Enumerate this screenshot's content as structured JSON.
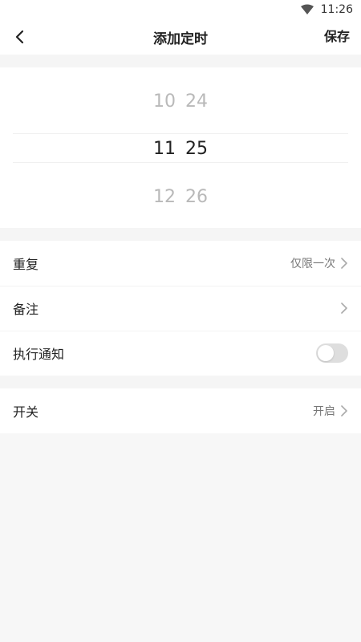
{
  "status_bar": {
    "time": "11:26",
    "wifi_icon": "wifi-icon"
  },
  "header": {
    "title": "添加定时",
    "save_label": "保存",
    "back_icon": "chevron-left-icon"
  },
  "time_picker": {
    "rows": [
      {
        "hour": "10",
        "minute": "24"
      },
      {
        "hour": "11",
        "minute": "25"
      },
      {
        "hour": "12",
        "minute": "26"
      }
    ],
    "selected_index": 1
  },
  "settings": {
    "repeat": {
      "label": "重复",
      "value": "仅限一次"
    },
    "note": {
      "label": "备注",
      "value": ""
    },
    "notify": {
      "label": "执行通知",
      "enabled": false
    }
  },
  "switch_section": {
    "label": "开关",
    "value": "开启"
  },
  "colors": {
    "accent": "#222222",
    "muted": "#b9b9b9",
    "toggle_off": "#dedede",
    "background": "#f7f7f7"
  }
}
